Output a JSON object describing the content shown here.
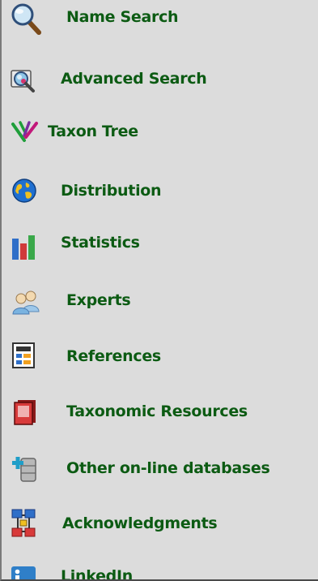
{
  "menu": {
    "items": [
      {
        "label": "Name Search",
        "icon": "magnifier-icon"
      },
      {
        "label": "Advanced Search",
        "icon": "advanced-search-icon"
      },
      {
        "label": "Taxon Tree",
        "icon": "taxon-tree-icon"
      },
      {
        "label": "Distribution",
        "icon": "globe-icon"
      },
      {
        "label": "Statistics",
        "icon": "bar-chart-icon"
      },
      {
        "label": "Experts",
        "icon": "people-icon"
      },
      {
        "label": "References",
        "icon": "document-icon"
      },
      {
        "label": "Taxonomic Resources",
        "icon": "book-icon"
      },
      {
        "label": "Other on-line databases",
        "icon": "database-add-icon"
      },
      {
        "label": "Acknowledgments",
        "icon": "network-icon"
      },
      {
        "label": "LinkedIn",
        "icon": "linkedin-icon"
      }
    ]
  },
  "colors": {
    "label": "#0c5b13",
    "background": "#dcdcdc"
  }
}
